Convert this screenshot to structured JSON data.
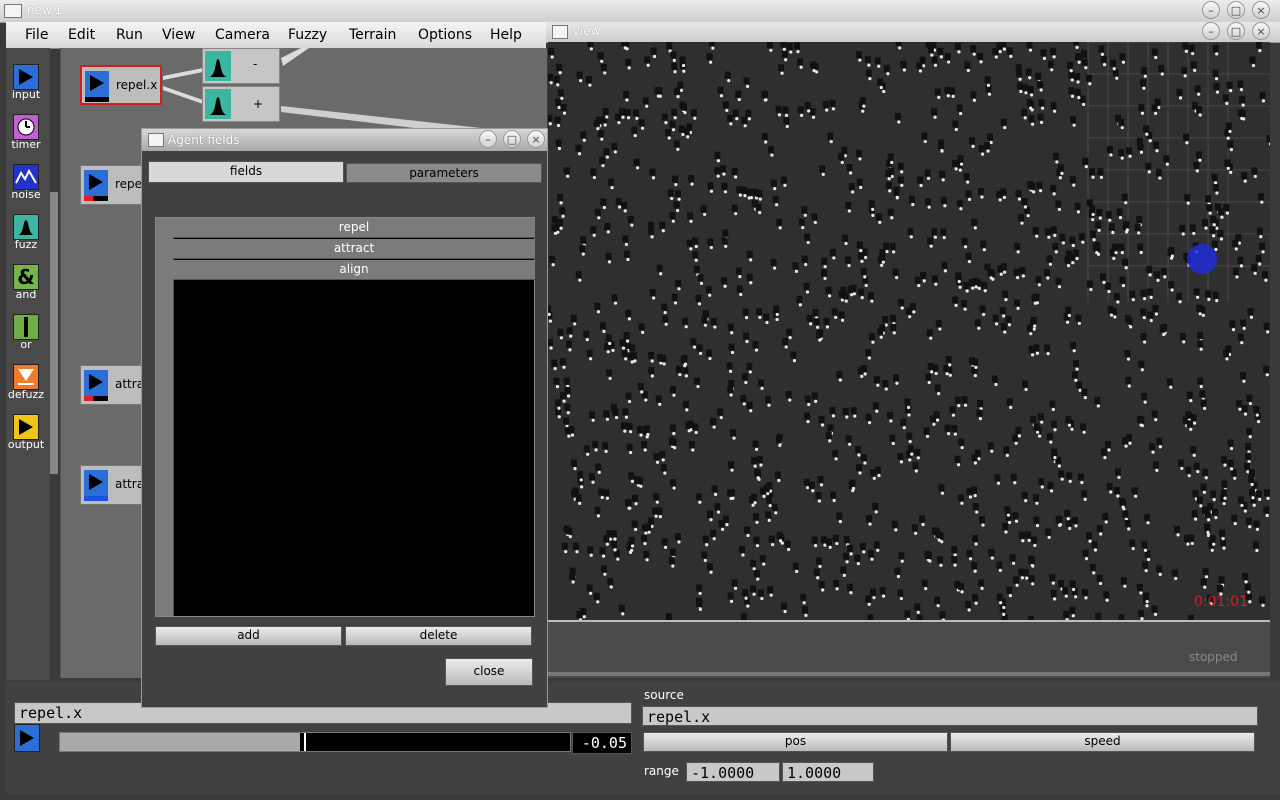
{
  "main_window": {
    "title": "new.1"
  },
  "view_window": {
    "title": "View",
    "timer": "0:01:01",
    "status": "stopped"
  },
  "menubar": {
    "items": [
      "File",
      "Edit",
      "Run",
      "View",
      "Camera",
      "Fuzzy",
      "Terrain",
      "Options",
      "Help"
    ]
  },
  "palette": {
    "items": [
      {
        "label": "input",
        "color": "#2b6fd6"
      },
      {
        "label": "timer",
        "color": "#c35fd4"
      },
      {
        "label": "noise",
        "color": "#2233cc"
      },
      {
        "label": "fuzz",
        "color": "#3bb6a0"
      },
      {
        "label": "and",
        "color": "#74b44a"
      },
      {
        "label": "or",
        "color": "#6fae45"
      },
      {
        "label": "defuzz",
        "color": "#f07b2a"
      },
      {
        "label": "output",
        "color": "#f2c41a"
      }
    ]
  },
  "nodes": [
    {
      "label": "repel.x"
    },
    {
      "label": "repe"
    },
    {
      "label": "attrac"
    },
    {
      "label": "attrac"
    }
  ],
  "fuzz_nodes": [
    {
      "label": "-"
    },
    {
      "label": "+"
    }
  ],
  "dialog": {
    "title": "Agent fields",
    "tabs": [
      "fields",
      "parameters"
    ],
    "fields": [
      "repel",
      "attract",
      "align"
    ],
    "add_label": "add",
    "delete_label": "delete",
    "close_label": "close"
  },
  "bottom": {
    "name_value": "repel.x",
    "value_display": "-0.05",
    "slider_fraction": 0.47,
    "source_label": "source",
    "source_value": "repel.x",
    "pos_label": "pos",
    "speed_label": "speed",
    "range_label": "range",
    "range_min": "-1.0000",
    "range_max": "1.0000"
  }
}
